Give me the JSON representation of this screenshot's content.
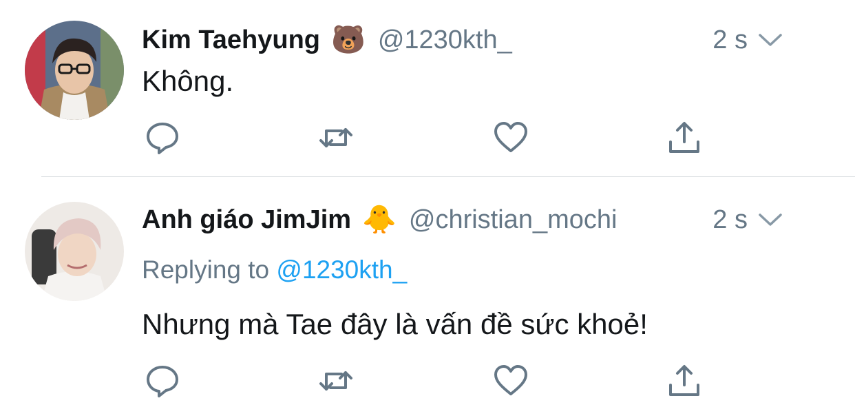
{
  "tweets": [
    {
      "author_name": "Kim Taehyung",
      "badge_emoji": "🐻",
      "handle": "@1230kth_",
      "time": "2 s",
      "text": "Không."
    },
    {
      "author_name": "Anh giáo JimJim",
      "badge_emoji": "🐥",
      "handle": "@christian_mochi",
      "time": "2 s",
      "replying_prefix": "Replying to",
      "replying_handle": "@1230kth_",
      "text": "Nhưng mà Tae đây là vấn đề sức khoẻ!"
    }
  ],
  "icons": {
    "reply": "comment-bubble-icon",
    "retweet": "retweet-icon",
    "like": "heart-icon",
    "share": "share-icon",
    "menu": "chevron-down-icon"
  },
  "colors": {
    "icon_gray": "#657786",
    "mention_blue": "#1da1f2",
    "text_dark": "#14171a",
    "divider": "#dcdfe2"
  }
}
